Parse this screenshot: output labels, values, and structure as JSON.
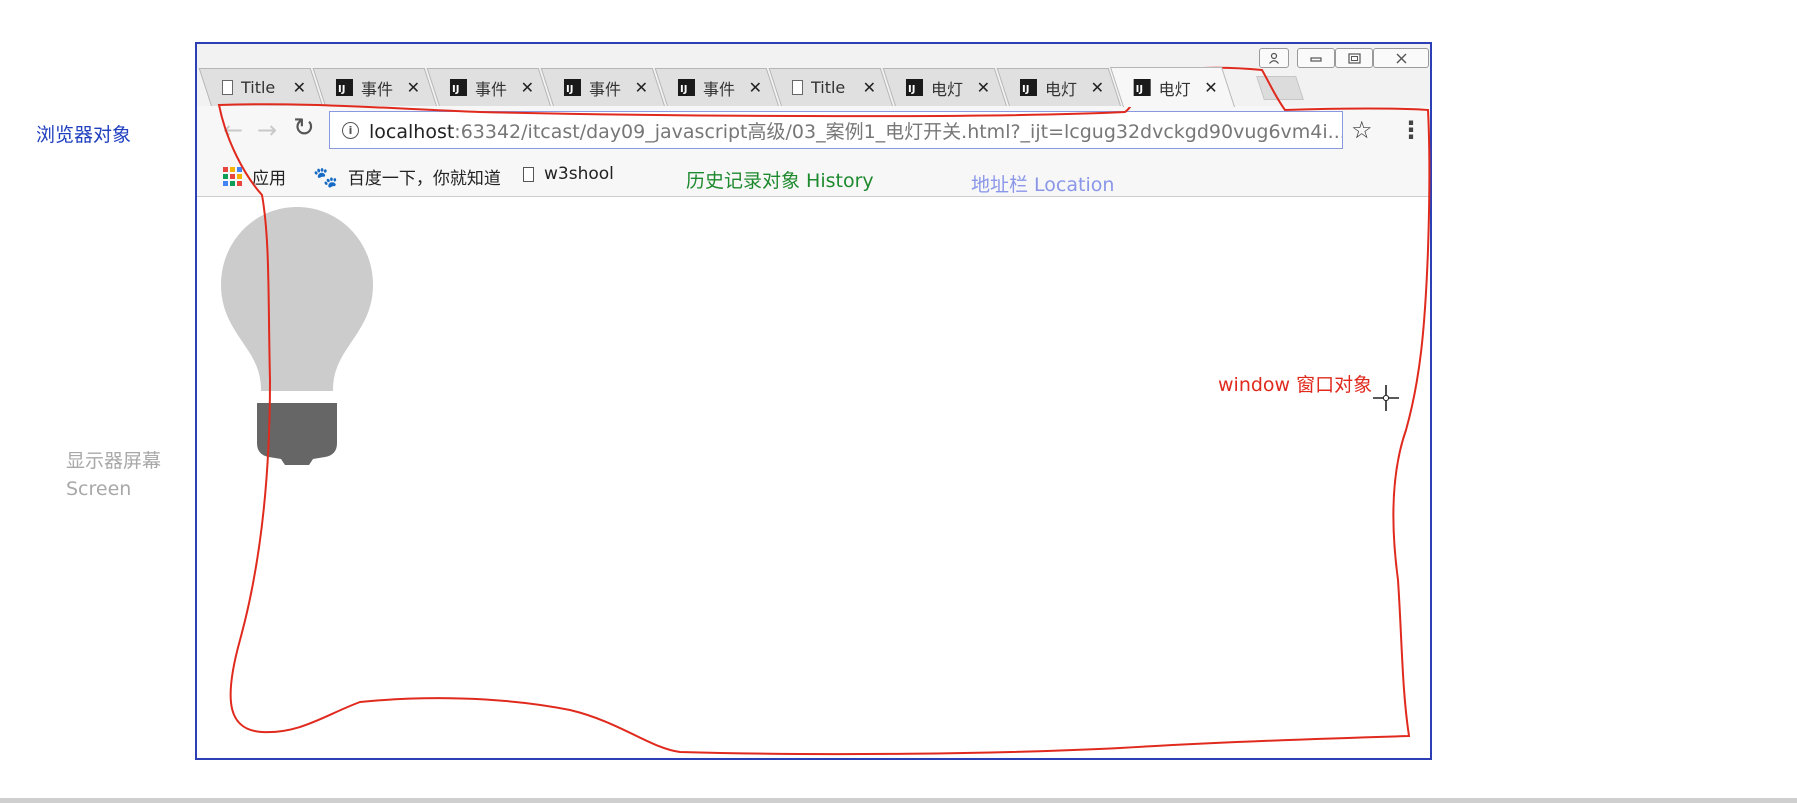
{
  "labels": {
    "browser_object": "浏览器对象",
    "screen_cn": "显示器屏幕",
    "screen_en": "Screen"
  },
  "window_controls": {
    "user_icon": "person-icon",
    "minimize_icon": "minimize-icon",
    "maximize_icon": "maximize-icon",
    "close_icon": "close-icon"
  },
  "tabs": [
    {
      "title": "Title",
      "favicon": "page-icon"
    },
    {
      "title": "事件",
      "favicon": "intellij-icon"
    },
    {
      "title": "事件",
      "favicon": "intellij-icon"
    },
    {
      "title": "事件",
      "favicon": "intellij-icon"
    },
    {
      "title": "事件",
      "favicon": "intellij-icon"
    },
    {
      "title": "Title",
      "favicon": "page-icon"
    },
    {
      "title": "电灯",
      "favicon": "intellij-icon"
    },
    {
      "title": "电灯",
      "favicon": "intellij-icon"
    },
    {
      "title": "电灯",
      "favicon": "intellij-icon",
      "active": true
    }
  ],
  "address_bar": {
    "host": "localhost",
    "path": ":63342/itcast/day09_javascript高级/03_案例1_电灯开关.html?_ijt=lcgug32dvckgd90vug6vm4i..."
  },
  "bookmarks": {
    "apps": "应用",
    "baidu": "百度一下，你就知道",
    "w3": "w3shool"
  },
  "annotations": {
    "history": "历史记录对象 History",
    "location": "地址栏 Location",
    "window": "window 窗口对象"
  },
  "colors": {
    "window_border": "#2d3fb4",
    "annotation_red": "#e02a1e",
    "annotation_green": "#1e8a2e",
    "annotation_blue": "#8a96e8",
    "label_blue": "#1f3fbf",
    "bulb_glass": "#cccccc",
    "bulb_base": "#666666"
  }
}
